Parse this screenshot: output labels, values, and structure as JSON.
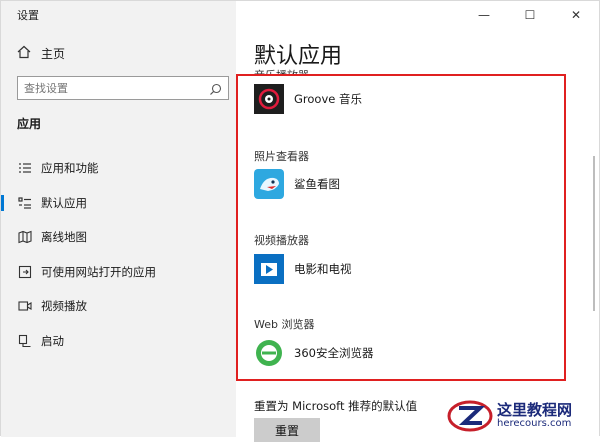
{
  "window": {
    "title": "设置",
    "controls": {
      "minimize": "—",
      "maximize": "☐",
      "close": "✕"
    }
  },
  "sidebar": {
    "home_label": "主页",
    "search": {
      "placeholder": "查找设置"
    },
    "section_title": "应用",
    "items": [
      {
        "label": "应用和功能",
        "icon": "apps-list-icon"
      },
      {
        "label": "默认应用",
        "icon": "default-apps-icon",
        "active": true
      },
      {
        "label": "离线地图",
        "icon": "offline-map-icon"
      },
      {
        "label": "可使用网站打开的应用",
        "icon": "open-with-site-icon"
      },
      {
        "label": "视频播放",
        "icon": "video-playback-icon"
      },
      {
        "label": "启动",
        "icon": "startup-icon"
      }
    ]
  },
  "main": {
    "page_title": "默认应用",
    "cut_category": "音乐播放器",
    "music": {
      "app": "Groove 音乐",
      "icon": "groove-music-icon"
    },
    "photo": {
      "category": "照片查看器",
      "app": "鲨鱼看图",
      "icon": "shark-viewer-icon"
    },
    "video": {
      "category": "视频播放器",
      "app": "电影和电视",
      "icon": "movies-tv-icon"
    },
    "browser": {
      "category": "Web 浏览器",
      "app": "360安全浏览器",
      "icon": "360-browser-icon"
    },
    "reset_text": "重置为 Microsoft 推荐的默认值",
    "reset_button": "重置",
    "highlight_color": "#e02020",
    "accent_color": "#0078d4"
  },
  "watermark": {
    "cn": "这里教程网",
    "en": "herecours.com"
  }
}
